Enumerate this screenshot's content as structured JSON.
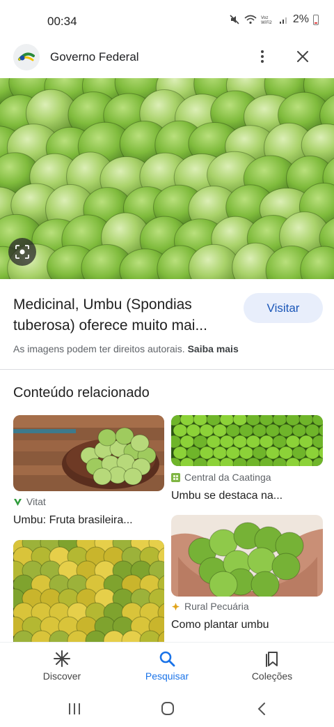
{
  "status_bar": {
    "time": "00:34",
    "battery": "2%",
    "icons": [
      "mute-icon",
      "wifi-icon",
      "volte-icon",
      "signal-icon",
      "battery-icon"
    ],
    "wifi_label": "Voz WiFi2"
  },
  "header": {
    "site_name": "Governo Federal",
    "more_icon": "more-vert-icon",
    "close_icon": "close-icon"
  },
  "result": {
    "title": "Medicinal, Umbu (Spondias tuberosa) oferece muito mai...",
    "visit_label": "Visitar",
    "copyright_text": "As imagens podem ter direitos autorais.",
    "learn_more": "Saiba mais"
  },
  "related": {
    "heading": "Conteúdo relacionado",
    "cards": [
      {
        "source": "Vitat",
        "caption": "Umbu: Fruta brasileira..."
      },
      {
        "source": "Central da Caatinga",
        "caption": "Umbu se destaca na..."
      },
      {
        "source": "",
        "caption": ""
      },
      {
        "source": "Rural Pecuária",
        "caption": "Como plantar umbu"
      }
    ]
  },
  "bottom_nav": {
    "items": [
      {
        "label": "Discover",
        "icon": "asterisk-icon"
      },
      {
        "label": "Pesquisar",
        "icon": "search-icon"
      },
      {
        "label": "Coleções",
        "icon": "bookmarks-icon"
      }
    ]
  },
  "colors": {
    "accent": "#1a73e8",
    "visit_bg": "#e8eefb",
    "visit_text": "#1a56b8",
    "fruit_green": "#8cc63f"
  }
}
